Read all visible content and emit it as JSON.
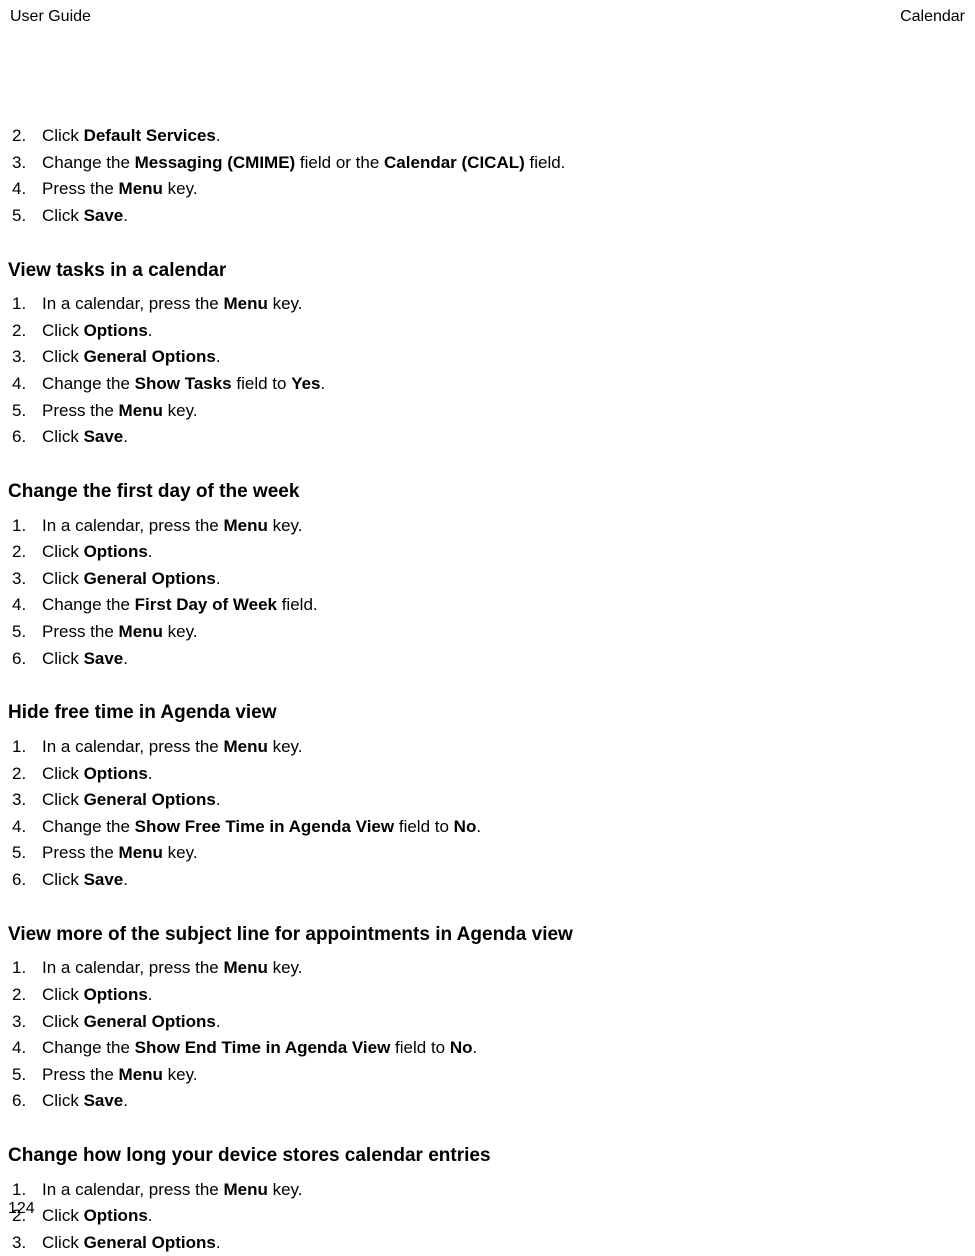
{
  "header": {
    "left": "User Guide",
    "right": "Calendar"
  },
  "pageNumber": "124",
  "topSteps": [
    {
      "n": "2.",
      "parts": [
        "Click ",
        {
          "b": "Default Services"
        },
        "."
      ]
    },
    {
      "n": "3.",
      "parts": [
        "Change the ",
        {
          "b": "Messaging (CMIME)"
        },
        " field or the ",
        {
          "b": "Calendar (CICAL)"
        },
        " field."
      ]
    },
    {
      "n": "4.",
      "parts": [
        "Press the ",
        {
          "b": "Menu"
        },
        " key."
      ]
    },
    {
      "n": "5.",
      "parts": [
        "Click ",
        {
          "b": "Save"
        },
        "."
      ]
    }
  ],
  "sections": [
    {
      "heading": "View tasks in a calendar",
      "steps": [
        {
          "n": "1.",
          "parts": [
            "In a calendar, press the ",
            {
              "b": "Menu"
            },
            " key."
          ]
        },
        {
          "n": "2.",
          "parts": [
            "Click ",
            {
              "b": "Options"
            },
            "."
          ]
        },
        {
          "n": "3.",
          "parts": [
            "Click ",
            {
              "b": "General Options"
            },
            "."
          ]
        },
        {
          "n": "4.",
          "parts": [
            "Change the ",
            {
              "b": "Show Tasks"
            },
            " field to ",
            {
              "b": "Yes"
            },
            "."
          ]
        },
        {
          "n": "5.",
          "parts": [
            "Press the ",
            {
              "b": "Menu"
            },
            " key."
          ]
        },
        {
          "n": "6.",
          "parts": [
            "Click ",
            {
              "b": "Save"
            },
            "."
          ]
        }
      ]
    },
    {
      "heading": "Change the first day of the week",
      "steps": [
        {
          "n": "1.",
          "parts": [
            "In a calendar, press the ",
            {
              "b": "Menu"
            },
            " key."
          ]
        },
        {
          "n": "2.",
          "parts": [
            "Click ",
            {
              "b": "Options"
            },
            "."
          ]
        },
        {
          "n": "3.",
          "parts": [
            "Click ",
            {
              "b": "General Options"
            },
            "."
          ]
        },
        {
          "n": "4.",
          "parts": [
            "Change the ",
            {
              "b": "First Day of Week"
            },
            " field."
          ]
        },
        {
          "n": "5.",
          "parts": [
            "Press the ",
            {
              "b": "Menu"
            },
            " key."
          ]
        },
        {
          "n": "6.",
          "parts": [
            "Click ",
            {
              "b": "Save"
            },
            "."
          ]
        }
      ]
    },
    {
      "heading": "Hide free time in Agenda view",
      "steps": [
        {
          "n": "1.",
          "parts": [
            "In a calendar, press the ",
            {
              "b": "Menu"
            },
            " key."
          ]
        },
        {
          "n": "2.",
          "parts": [
            "Click ",
            {
              "b": "Options"
            },
            "."
          ]
        },
        {
          "n": "3.",
          "parts": [
            "Click ",
            {
              "b": "General Options"
            },
            "."
          ]
        },
        {
          "n": "4.",
          "parts": [
            "Change the ",
            {
              "b": "Show Free Time in Agenda View"
            },
            " field to ",
            {
              "b": "No"
            },
            "."
          ]
        },
        {
          "n": "5.",
          "parts": [
            "Press the ",
            {
              "b": "Menu"
            },
            " key."
          ]
        },
        {
          "n": "6.",
          "parts": [
            "Click ",
            {
              "b": "Save"
            },
            "."
          ]
        }
      ]
    },
    {
      "heading": "View more of the subject line for appointments in Agenda view",
      "steps": [
        {
          "n": "1.",
          "parts": [
            "In a calendar, press the ",
            {
              "b": "Menu"
            },
            " key."
          ]
        },
        {
          "n": "2.",
          "parts": [
            "Click ",
            {
              "b": "Options"
            },
            "."
          ]
        },
        {
          "n": "3.",
          "parts": [
            "Click ",
            {
              "b": "General Options"
            },
            "."
          ]
        },
        {
          "n": "4.",
          "parts": [
            "Change the ",
            {
              "b": "Show End Time in Agenda View"
            },
            " field to ",
            {
              "b": "No"
            },
            "."
          ]
        },
        {
          "n": "5.",
          "parts": [
            "Press the ",
            {
              "b": "Menu"
            },
            " key."
          ]
        },
        {
          "n": "6.",
          "parts": [
            "Click ",
            {
              "b": "Save"
            },
            "."
          ]
        }
      ]
    },
    {
      "heading": "Change how long your device stores calendar entries",
      "steps": [
        {
          "n": "1.",
          "parts": [
            "In a calendar, press the ",
            {
              "b": "Menu"
            },
            " key."
          ]
        },
        {
          "n": "2.",
          "parts": [
            "Click ",
            {
              "b": "Options"
            },
            "."
          ]
        },
        {
          "n": "3.",
          "parts": [
            "Click ",
            {
              "b": "General Options"
            },
            "."
          ]
        }
      ]
    }
  ]
}
